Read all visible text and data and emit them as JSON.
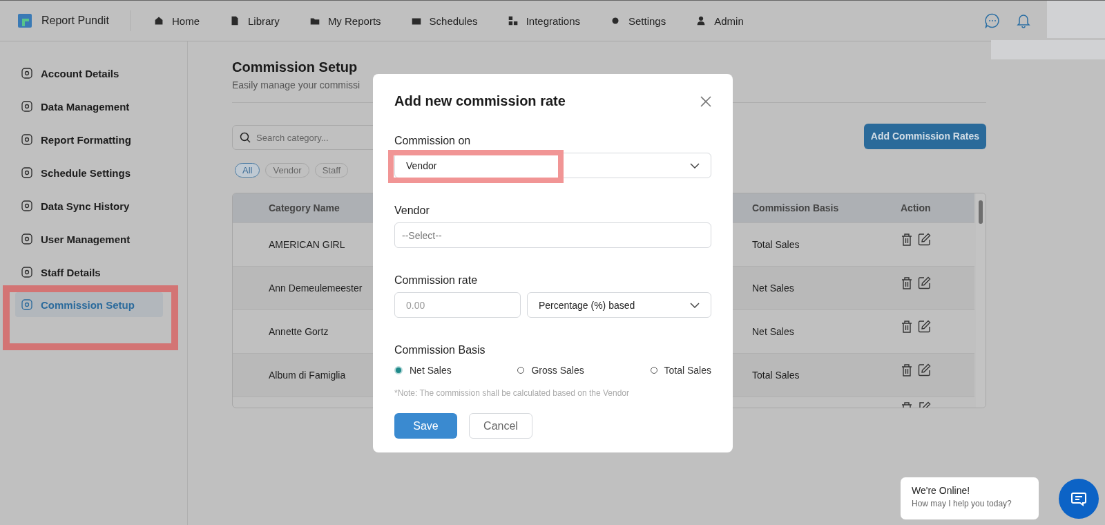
{
  "app": {
    "name": "Report Pundit"
  },
  "nav": [
    {
      "label": "Home"
    },
    {
      "label": "Library"
    },
    {
      "label": "My Reports"
    },
    {
      "label": "Schedules"
    },
    {
      "label": "Integrations"
    },
    {
      "label": "Settings"
    },
    {
      "label": "Admin"
    }
  ],
  "sidebar": {
    "items": [
      {
        "label": "Account Details",
        "selected": false,
        "highlighted": false
      },
      {
        "label": "Data Management",
        "selected": false,
        "highlighted": false
      },
      {
        "label": "Report Formatting",
        "selected": false,
        "highlighted": false
      },
      {
        "label": "Schedule Settings",
        "selected": false,
        "highlighted": false
      },
      {
        "label": "Data Sync History",
        "selected": false,
        "highlighted": false
      },
      {
        "label": "User Management",
        "selected": false,
        "highlighted": false
      },
      {
        "label": "Staff Details",
        "selected": false,
        "highlighted": false
      },
      {
        "label": "Commission Setup",
        "selected": true,
        "highlighted": true
      }
    ]
  },
  "page": {
    "title": "Commission Setup",
    "subtitle": "Easily manage your commissi",
    "search": {
      "placeholder": "Search category..."
    },
    "filters": [
      {
        "label": "All",
        "selected": true
      },
      {
        "label": "Vendor",
        "selected": false
      },
      {
        "label": "Staff",
        "selected": false
      }
    ],
    "add_button": "Add Commission Rates",
    "table": {
      "columns": [
        "Category Name",
        "Commission Basis",
        "Action"
      ],
      "rows": [
        {
          "category": "AMERICAN GIRL",
          "basis": "Total Sales"
        },
        {
          "category": "Ann Demeulemeester",
          "basis": "Net Sales"
        },
        {
          "category": "Annette Gortz",
          "basis": "Net Sales"
        },
        {
          "category": "Album di Famiglia",
          "basis": "Total Sales"
        }
      ]
    }
  },
  "modal": {
    "title": "Add new commission rate",
    "commission_on": {
      "label": "Commission on",
      "value": "Vendor",
      "highlighted": true
    },
    "vendor": {
      "label": "Vendor",
      "placeholder": "--Select--"
    },
    "rate": {
      "label": "Commission rate",
      "placeholder": "0.00",
      "type": "Percentage (%) based"
    },
    "basis": {
      "label": "Commission Basis",
      "options": [
        {
          "label": "Net Sales",
          "selected": true
        },
        {
          "label": "Gross Sales",
          "selected": false
        },
        {
          "label": "Total Sales",
          "selected": false
        }
      ]
    },
    "note": "*Note: The commission shall be calculated based on the Vendor",
    "buttons": {
      "save": "Save",
      "cancel": "Cancel"
    }
  },
  "chat": {
    "title": "We're Online!",
    "subtitle": "How may I help you today?"
  }
}
